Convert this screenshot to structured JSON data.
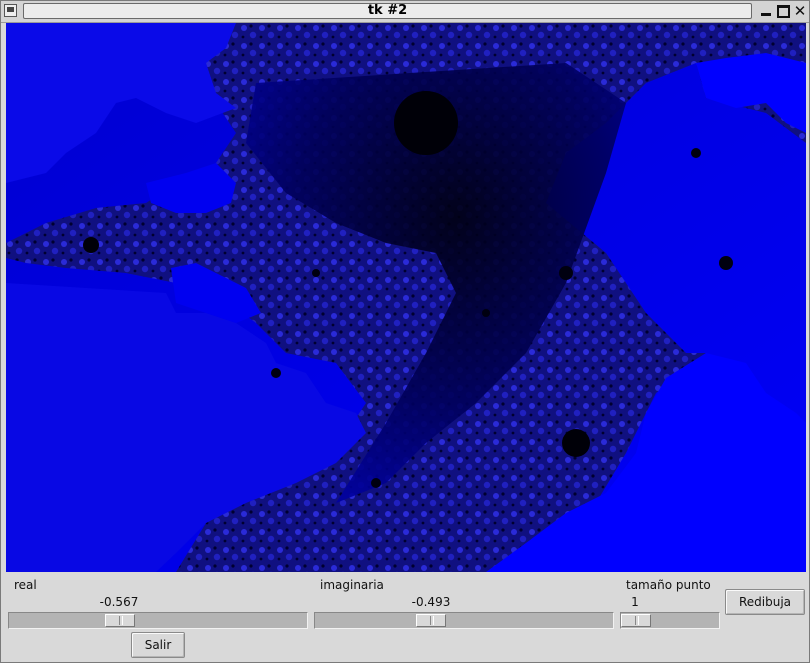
{
  "window": {
    "title": "tk #2"
  },
  "colors": {
    "fractal_blue": "#0000d8",
    "fractal_bright": "#1414ff",
    "fractal_dark": "#000000",
    "panel_bg": "#d9d9d9"
  },
  "controls": {
    "real": {
      "label": "real",
      "value": "-0.567"
    },
    "imaginaria": {
      "label": "imaginaria",
      "value": "-0.493"
    },
    "tamano_punto": {
      "label": "tamaño punto",
      "value": "1"
    },
    "redibuja_label": "Redibuja",
    "salir_label": "Salir"
  }
}
